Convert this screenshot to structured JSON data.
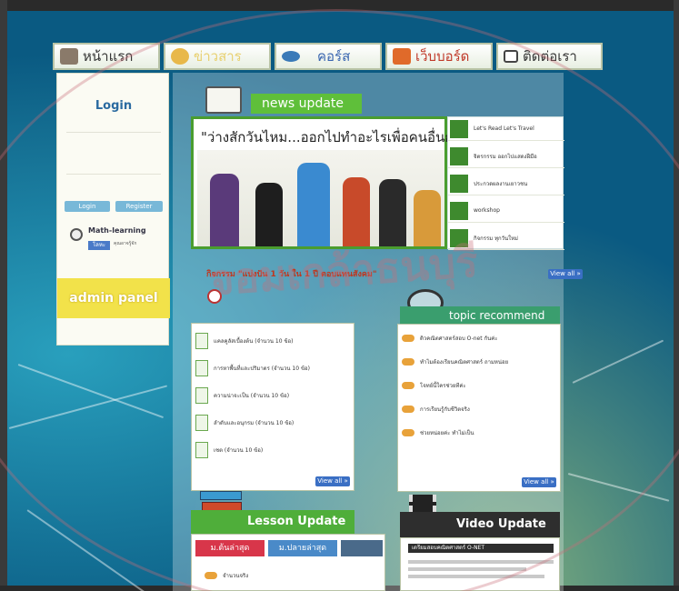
{
  "nav": {
    "items": [
      {
        "label": "หน้าแรก",
        "icon": "home-icon",
        "color": "#8a7a6a"
      },
      {
        "label": "ข่าวสาร",
        "icon": "news-icon",
        "color": "#e8b84a"
      },
      {
        "label": "คอร์ส",
        "icon": "course-icon",
        "color": "#3a7ab8"
      },
      {
        "label": "เว็บบอร์ด",
        "icon": "webboard-icon",
        "color": "#e06a2a"
      },
      {
        "label": "ติดต่อเรา",
        "icon": "contact-icon",
        "color": "#444444"
      }
    ]
  },
  "left_panel": {
    "login_title": "Login",
    "login_button": "Login",
    "register_button": "Register",
    "user_name": "Math-learning",
    "user_badge": "โลหะ",
    "user_note": "คุณอาจรู้จัก",
    "admin_panel": "admin panel"
  },
  "news": {
    "header": "news update",
    "headline": "\"ว่างสักวันไหม...ออกไปทำอะไรเพื่อคนอื่นกัน\"",
    "side_items": [
      "Let's Read Let's Travel",
      "จิตรกรรม ออกไปแสดงฝีมือ",
      "ประกวดผลงานเยาวชน",
      "workshop",
      "กิจกรรม ทุกวันใหม่"
    ],
    "caption": "กิจกรรม \"แบ่งปัน 1 วัน ใน 1 ปี ตอบแทนสังคม\"",
    "view_all": "View all »"
  },
  "course": {
    "items": [
      "แคลคูลัสเบื้องต้น (จำนวน 10 ข้อ)",
      "การหาพื้นที่และปริมาตร (จำนวน 10 ข้อ)",
      "ความน่าจะเป็น (จำนวน 10 ข้อ)",
      "ลำดับและอนุกรม (จำนวน 10 ข้อ)",
      "เซต (จำนวน 10 ข้อ)"
    ],
    "view_all": "View all »"
  },
  "topic": {
    "header": "topic recommend",
    "items": [
      "ติวคณิตศาสตร์สอบ O-net กันค่ะ",
      "ทำไมต้องเรียนคณิตศาสตร์ ถามหน่อย",
      "โจทย์นี้ใครช่วยทีค่ะ",
      "การเรียนรู้กับชีวิตจริง",
      "ช่วยหน่อยค่ะ ทำไม่เป็น"
    ],
    "view_all": "View all »"
  },
  "lesson": {
    "header": "Lesson Update",
    "tab_active": "ม.ต้นล่าสุด",
    "tab_inactive": "ม.ปลายล่าสุด",
    "first_item": "จำนวนจริง"
  },
  "video": {
    "header": "Video Update",
    "first_item": "เตรียมสอบคณิตศาสตร์ O-NET"
  },
  "watermark": {
    "text": "จอมเกล้าธนบุรี"
  },
  "colors": {
    "news_green": "#4a9d2f",
    "topic_green": "#3a9e6e",
    "view_all_blue": "#3a6fc4",
    "admin_yellow": "#f2e24a",
    "caption_red": "#c0361e"
  }
}
